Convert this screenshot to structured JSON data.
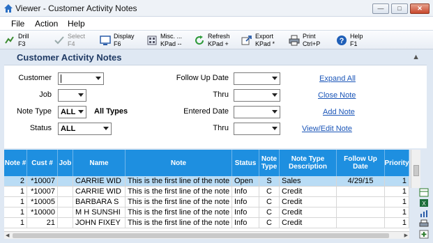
{
  "window": {
    "title": "Viewer - Customer Activity Notes"
  },
  "menu": [
    "File",
    "Action",
    "Help"
  ],
  "toolbar": [
    {
      "label1": "Drill",
      "label2": "F3",
      "icon": "drill-icon",
      "enabled": true
    },
    {
      "label1": "Select",
      "label2": "F4",
      "icon": "check-icon",
      "enabled": false
    },
    {
      "label1": "Display",
      "label2": "F6",
      "icon": "display-icon",
      "enabled": true
    },
    {
      "label1": "Misc. ...",
      "label2": "KPad --",
      "icon": "misc-icon",
      "enabled": true
    },
    {
      "label1": "Refresh",
      "label2": "KPad +",
      "icon": "refresh-icon",
      "enabled": true
    },
    {
      "label1": "Export",
      "label2": "KPad *",
      "icon": "export-icon",
      "enabled": true
    },
    {
      "label1": "Print",
      "label2": "Ctrl+P",
      "icon": "printer-icon",
      "enabled": true
    },
    {
      "label1": "Help",
      "label2": "F1",
      "icon": "help-icon",
      "enabled": true
    }
  ],
  "section": {
    "title": "Customer Activity Notes"
  },
  "form": {
    "customer_label": "Customer",
    "customer_value": "",
    "job_label": "Job",
    "job_value": "",
    "note_type_label": "Note Type",
    "note_type_value": "ALL",
    "note_type_desc": "All Types",
    "status_label": "Status",
    "status_value": "ALL",
    "follow_up_label": "Follow Up Date",
    "follow_up_value": "",
    "thru1_label": "Thru",
    "thru1_value": "",
    "entered_label": "Entered Date",
    "entered_value": "",
    "thru2_label": "Thru",
    "thru2_value": "",
    "links": {
      "expand_all": "Expand All",
      "close_note": "Close Note",
      "add_note": "Add Note",
      "view_edit_note": "View/Edit Note"
    }
  },
  "grid": {
    "columns": [
      "Note #",
      "Cust #",
      "Job",
      "Name",
      "Note",
      "Status",
      "Note Type",
      "Note Type Description",
      "Follow Up Date",
      "Priority"
    ],
    "rows": [
      [
        "2",
        "*10007",
        "",
        "CARRIE WID",
        "This is the first line of the note",
        "Open",
        "S",
        "Sales",
        "4/29/15",
        "1"
      ],
      [
        "1",
        "*10007",
        "",
        "CARRIE WID",
        "This is the first line of the note",
        "Info",
        "C",
        "Credit",
        "",
        "1"
      ],
      [
        "1",
        "*10005",
        "",
        "BARBARA S",
        "This is the first line of the note",
        "Info",
        "C",
        "Credit",
        "",
        "1"
      ],
      [
        "1",
        "*10000",
        "",
        "M H SUNSHI",
        "This is the first line of the note",
        "Info",
        "C",
        "Credit",
        "",
        "1"
      ],
      [
        "1",
        "21",
        "",
        "JOHN FIXEY",
        "This is the first line of the note",
        "Info",
        "C",
        "Credit",
        "",
        "1"
      ]
    ],
    "selected_row": 0
  },
  "colors": {
    "header_blue": "#1e8fe0",
    "selected_row": "#b9dcf5",
    "link": "#1a55b8",
    "section_title": "#1f3a64"
  }
}
